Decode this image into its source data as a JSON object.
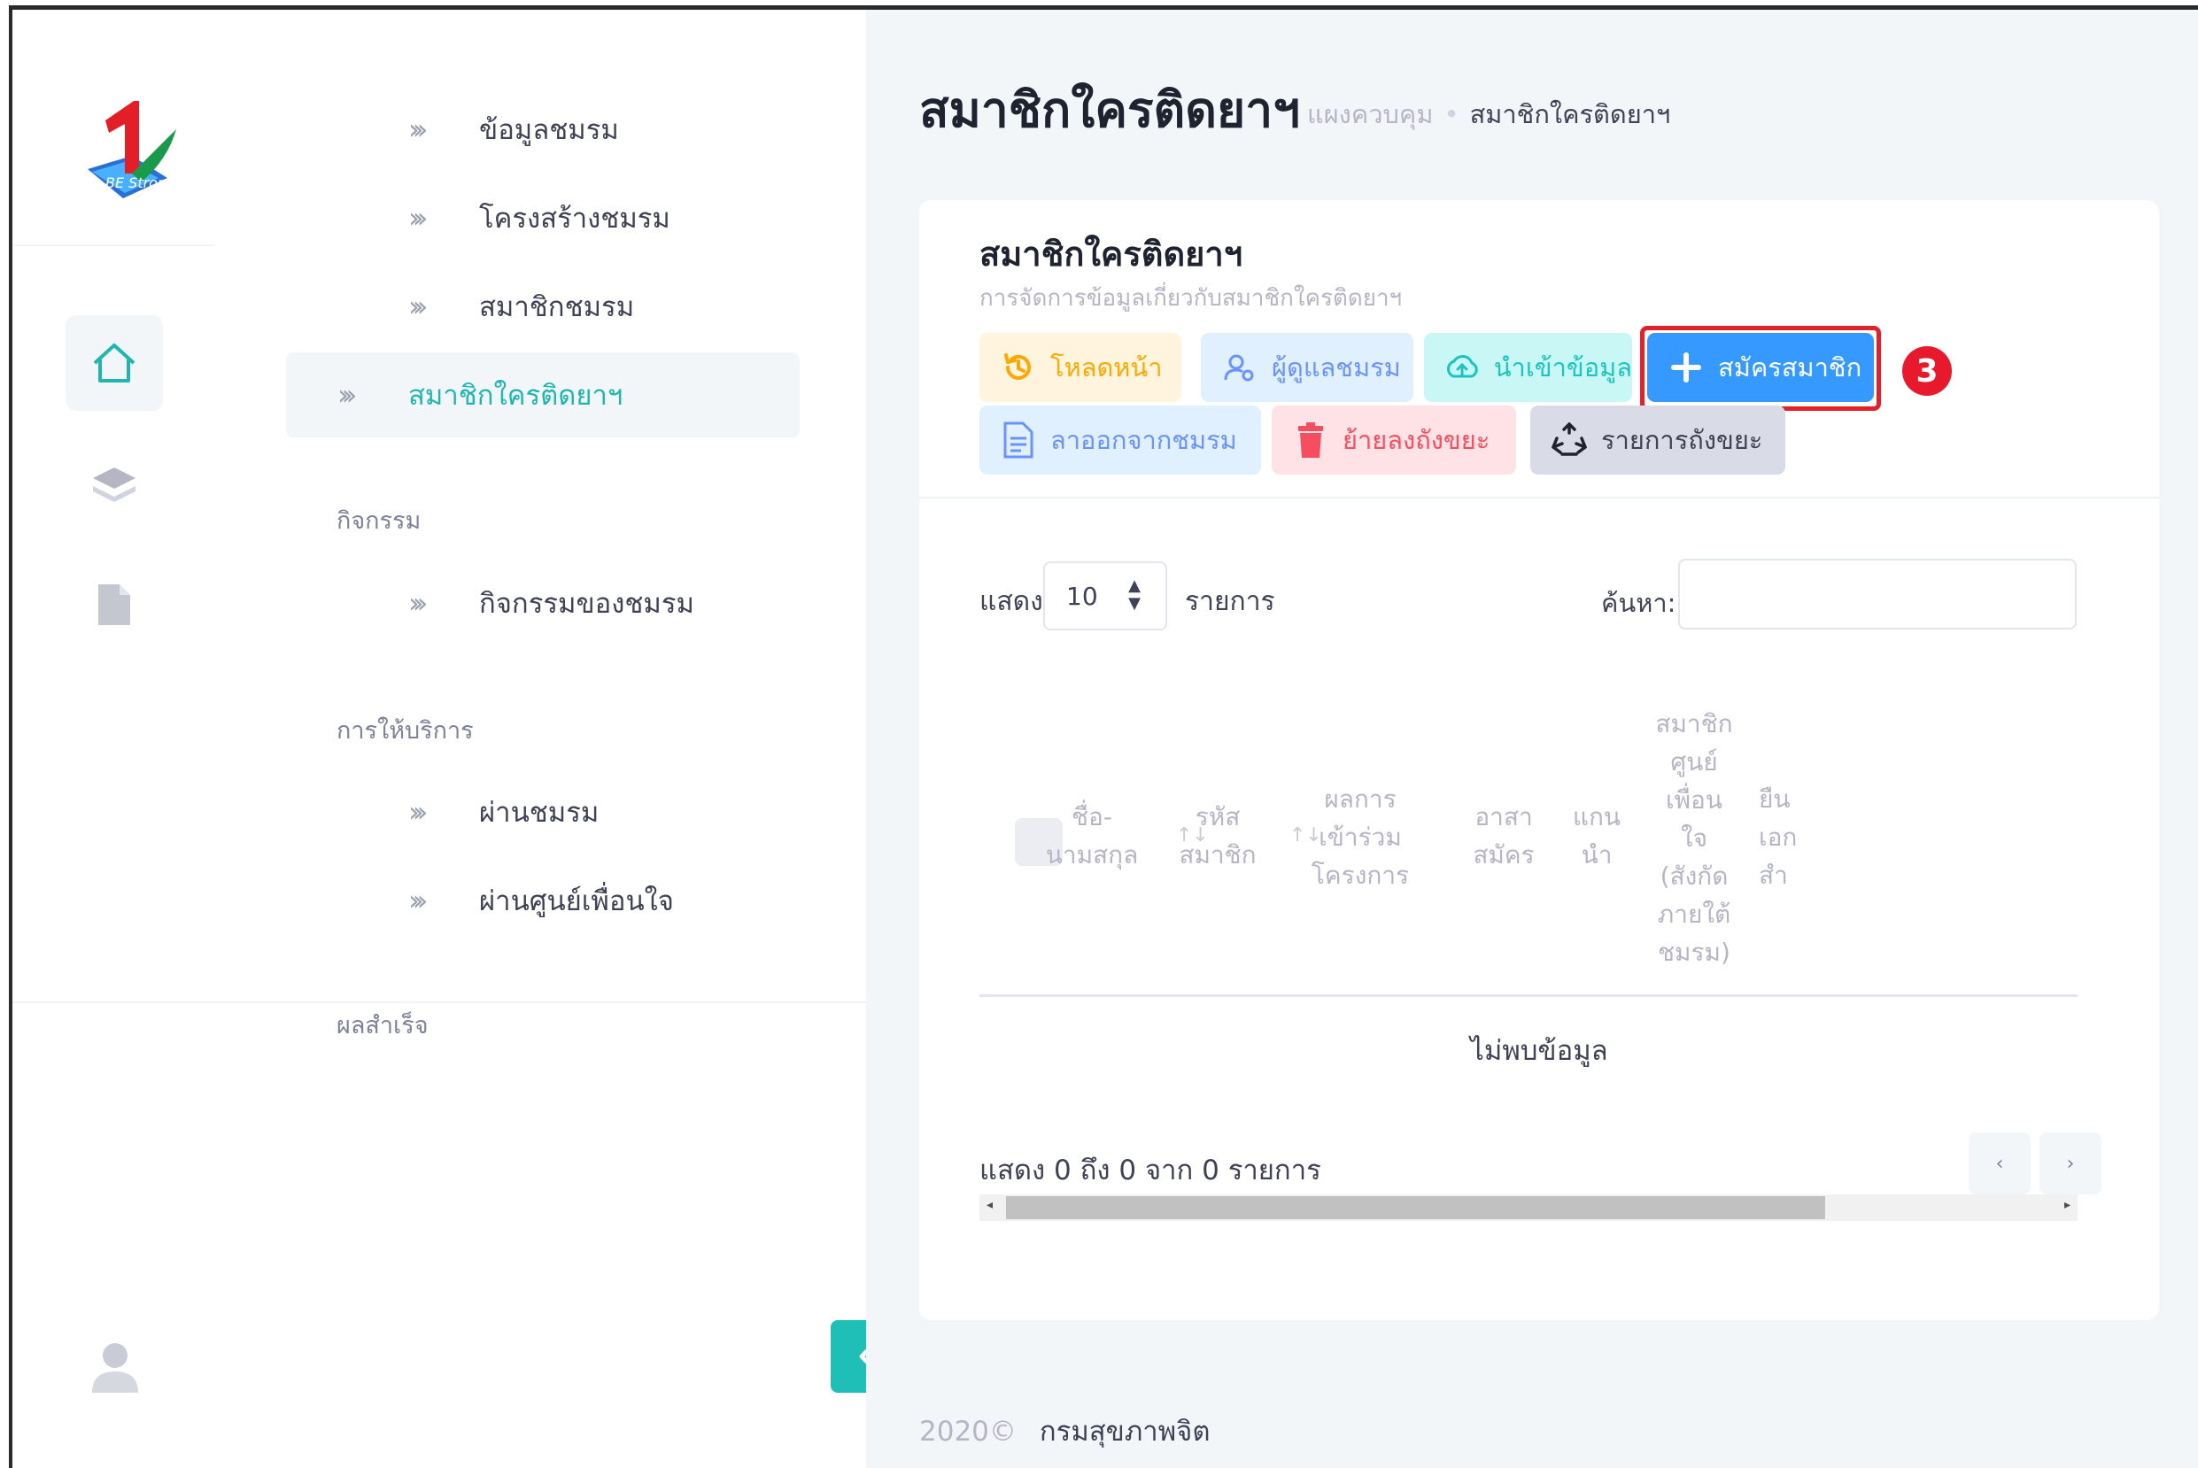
{
  "app": {
    "logo_alt": "BE Strong",
    "rail": [
      "home-icon",
      "layers-icon",
      "document-icon",
      "user-icon"
    ]
  },
  "menu": {
    "items_top": [
      {
        "label": "ข้อมูลชมรม"
      },
      {
        "label": "โครงสร้างชมรม"
      },
      {
        "label": "สมาชิกชมรม"
      },
      {
        "label": "สมาชิกใครติดยาฯ",
        "active": true
      }
    ],
    "section_activity": "กิจกรรม",
    "activity_items": [
      {
        "label": "กิจกรรมของชมรม"
      }
    ],
    "section_service": "การให้บริการ",
    "service_items": [
      {
        "label": "ผ่านชมรม"
      },
      {
        "label": "ผ่านศูนย์เพื่อนใจ"
      }
    ],
    "section_result": "ผลสำเร็จ"
  },
  "header": {
    "title": "สมาชิกใครติดยาฯ",
    "breadcrumb": [
      "แผงควบคุม",
      "สมาชิกใครติดยาฯ"
    ]
  },
  "card": {
    "title": "สมาชิกใครติดยาฯ",
    "subtitle": "การจัดการข้อมูลเกี่ยวกับสมาชิกใครติดยาฯ",
    "buttons": {
      "reload": "โหลดหน้า",
      "admin": "ผู้ดูแลชมรม",
      "import": "นำเข้าข้อมูล",
      "signup": "สมัครสมาชิก",
      "leave": "ลาออกจากชมรม",
      "trash": "ย้ายลงถังขยะ",
      "bin": "รายการถังขยะ"
    },
    "step_marker": "3",
    "colors": {
      "accent": "#1fbfb8",
      "primary": "#3699ff",
      "highlight": "#e3212a"
    }
  },
  "table": {
    "show_label": "แสดง",
    "page_length": "10",
    "items_label": "รายการ",
    "search_label": "ค้นหา:",
    "search_value": "",
    "headers": [
      "ชื่อ-\nนามสกุล",
      "รหัส\nสมาชิก",
      "ผลการ\nเข้าร่วม\nโครงการ",
      "อาสา\nสมัคร",
      "แกน\nนำ",
      "สมาชิก\nศูนย์\nเพื่อน\nใจ\n(สังกัด\nภายใต้\nชมรม)",
      "ยืน\nเอก\nสำ"
    ],
    "empty_text": "ไม่พบข้อมูล",
    "info_text": "แสดง 0 ถึง 0 จาก 0 รายการ",
    "prev": "‹",
    "next": "›"
  },
  "footer": {
    "year": "2020©",
    "org": "กรมสุขภาพจิต"
  }
}
